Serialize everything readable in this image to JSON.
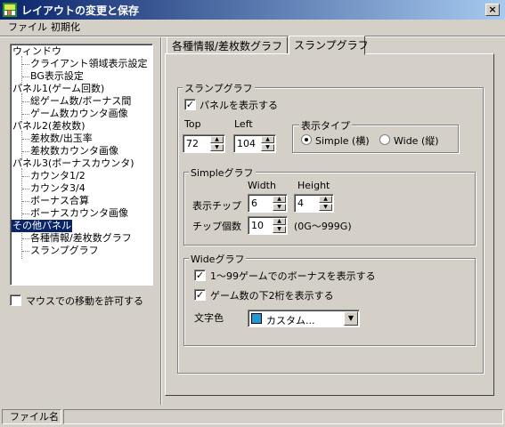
{
  "window": {
    "title": "レイアウトの変更と保存",
    "close_glyph": "×"
  },
  "menu": {
    "items": [
      "ファイル",
      "初期化"
    ]
  },
  "tree": {
    "items": [
      {
        "label": "ウィンドウ",
        "level": 0
      },
      {
        "label": "クライアント領域表示設定",
        "level": 1
      },
      {
        "label": "BG表示設定",
        "level": 1
      },
      {
        "label": "パネル1(ゲーム回数)",
        "level": 0
      },
      {
        "label": "総ゲーム数/ボーナス間",
        "level": 1
      },
      {
        "label": "ゲーム数カウンタ画像",
        "level": 1
      },
      {
        "label": "パネル2(差枚数)",
        "level": 0
      },
      {
        "label": "差枚数/出玉率",
        "level": 1
      },
      {
        "label": "差枚数カウンタ画像",
        "level": 1
      },
      {
        "label": "パネル3(ボーナスカウンタ)",
        "level": 0
      },
      {
        "label": "カウンタ1/2",
        "level": 1
      },
      {
        "label": "カウンタ3/4",
        "level": 1
      },
      {
        "label": "ボーナス合算",
        "level": 1
      },
      {
        "label": "ボーナスカウンタ画像",
        "level": 1
      },
      {
        "label": "その他パネル",
        "level": 0,
        "selected": true
      },
      {
        "label": "各種情報/差枚数グラフ",
        "level": 1
      },
      {
        "label": "スランプグラフ",
        "level": 1
      }
    ]
  },
  "mouse_move": {
    "label": "マウスでの移動を許可する",
    "checked": false
  },
  "tabs": [
    {
      "label": "各種情報/差枚数グラフ",
      "active": false
    },
    {
      "label": "スランプグラフ",
      "active": true
    }
  ],
  "slump": {
    "group_title": "スランプグラフ",
    "show_panel": {
      "label": "パネルを表示する",
      "checked": true
    },
    "top": {
      "label": "Top",
      "value": "72"
    },
    "left": {
      "label": "Left",
      "value": "104"
    },
    "display_type": {
      "title": "表示タイプ",
      "options": [
        {
          "label": "Simple (横)",
          "selected": true
        },
        {
          "label": "Wide (縦)",
          "selected": false
        }
      ]
    },
    "simple": {
      "title": "Simpleグラフ",
      "width_label": "Width",
      "height_label": "Height",
      "chip_label": "表示チップ",
      "chip_width": "6",
      "chip_height": "4",
      "chip_count_label": "チップ個数",
      "chip_count": "10",
      "chip_range": "(0G〜999G)"
    },
    "wide": {
      "title": "Wideグラフ",
      "bonus_check": {
        "label": "1〜99ゲームでのボーナスを表示する",
        "checked": true
      },
      "lower2_check": {
        "label": "ゲーム数の下2桁を表示する",
        "checked": true
      },
      "text_color_label": "文字色",
      "text_color_value": "カスタム...",
      "text_color_hex": "#1e9ad6"
    }
  },
  "status": {
    "pane1": "ファイル名",
    "pane2": ""
  },
  "colors": {
    "titlebar_start": "#0a246a",
    "titlebar_end": "#a6caf0",
    "face": "#d4d0c8",
    "selection": "#0a246a"
  }
}
